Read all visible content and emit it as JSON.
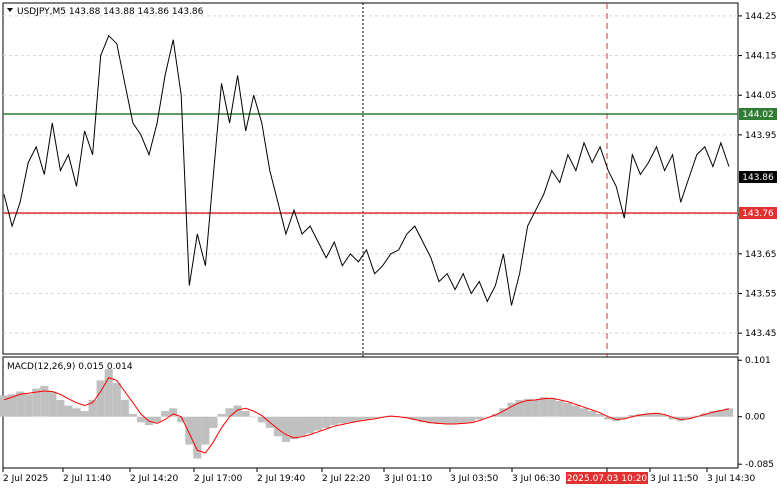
{
  "header": {
    "symbol_line": "USDJPY,M5  143.88 143.88 143.86 143.86"
  },
  "macd_panel": {
    "label": "MACD(12,26,9) 0.015 0.014"
  },
  "price_levels": {
    "resistance": {
      "label": "144.02",
      "value": 144.02,
      "color": "#2e7d32"
    },
    "support": {
      "label": "143.76",
      "value": 143.76,
      "color": "#e03030"
    },
    "current": {
      "label": "143.86",
      "value": 143.86
    }
  },
  "chart_data": [
    {
      "type": "line",
      "title": "USDJPY,M5",
      "ylim": [
        143.4,
        144.28
      ],
      "y_ticks": [
        "144.25",
        "144.15",
        "144.05",
        "143.95",
        "143.75",
        "143.65",
        "143.55",
        "143.45"
      ],
      "x_tick_labels": [
        "2 Jul 2025",
        "2 Jul 11:40",
        "2 Jul 14:20",
        "2 Jul 17:00",
        "2 Jul 19:40",
        "2 Jul 22:20",
        "3 Jul 01:10",
        "3 Jul 03:50",
        "3 Jul 06:30",
        "2025.07.03 10:20",
        "3 Jul 11:50",
        "3 Jul 14:30"
      ],
      "highlighted_x_label": "2025.07.03 10:20",
      "series": [
        {
          "values": [
            143.8,
            143.72,
            143.78,
            143.88,
            143.92,
            143.85,
            143.98,
            143.86,
            143.9,
            143.82,
            143.96,
            143.9,
            144.15,
            144.2,
            144.18,
            144.08,
            143.98,
            143.95,
            143.9,
            143.98,
            144.1,
            144.19,
            144.05,
            143.57,
            143.7,
            143.62,
            143.85,
            144.08,
            143.98,
            144.1,
            143.96,
            144.05,
            143.98,
            143.86,
            143.78,
            143.7,
            143.76,
            143.7,
            143.72,
            143.68,
            143.64,
            143.68,
            143.62,
            143.65,
            143.63,
            143.66,
            143.6,
            143.62,
            143.65,
            143.66,
            143.7,
            143.72,
            143.68,
            143.64,
            143.58,
            143.6,
            143.56,
            143.6,
            143.55,
            143.58,
            143.53,
            143.57,
            143.65,
            143.52,
            143.6,
            143.72,
            143.76,
            143.8,
            143.86,
            143.83,
            143.9,
            143.86,
            143.93,
            143.88,
            143.92,
            143.86,
            143.82,
            143.74,
            143.9,
            143.85,
            143.88,
            143.92,
            143.86,
            143.9,
            143.78,
            143.84,
            143.9,
            143.92,
            143.87,
            143.93,
            143.87
          ],
          "color": "#000000"
        }
      ]
    },
    {
      "type": "bar",
      "title": "MACD(12,26,9)",
      "ylim": [
        -0.09,
        0.105
      ],
      "y_ticks": [
        "0.101",
        "0.00",
        "-0.085"
      ],
      "series": [
        {
          "name": "MACD",
          "values": [
            0.038,
            0.04,
            0.045,
            0.04,
            0.05,
            0.055,
            0.045,
            0.03,
            0.02,
            0.015,
            0.01,
            0.03,
            0.065,
            0.085,
            0.06,
            0.03,
            0.005,
            -0.01,
            -0.015,
            -0.01,
            0.01,
            0.015,
            -0.01,
            -0.05,
            -0.075,
            -0.05,
            -0.02,
            0.005,
            0.015,
            0.02,
            0.01,
            0.0,
            -0.01,
            -0.02,
            -0.035,
            -0.045,
            -0.04,
            -0.035,
            -0.03,
            -0.025,
            -0.02,
            -0.015,
            -0.012,
            -0.01,
            -0.008,
            -0.005,
            -0.003,
            0.0,
            0.002,
            0.0,
            -0.003,
            -0.006,
            -0.01,
            -0.012,
            -0.013,
            -0.014,
            -0.013,
            -0.012,
            -0.01,
            -0.005,
            0.0,
            0.005,
            0.015,
            0.025,
            0.03,
            0.032,
            0.03,
            0.035,
            0.033,
            0.028,
            0.025,
            0.02,
            0.015,
            0.01,
            0.005,
            -0.005,
            -0.008,
            -0.003,
            0.003,
            0.005,
            0.006,
            0.007,
            0.003,
            -0.005,
            -0.008,
            -0.004,
            0.002,
            0.006,
            0.01,
            0.012,
            0.015
          ],
          "color": "#c0c0c0"
        },
        {
          "name": "Signal",
          "values": [
            0.03,
            0.035,
            0.04,
            0.042,
            0.044,
            0.046,
            0.045,
            0.04,
            0.032,
            0.025,
            0.02,
            0.025,
            0.045,
            0.07,
            0.065,
            0.045,
            0.025,
            0.005,
            -0.008,
            -0.012,
            -0.005,
            0.005,
            0.0,
            -0.03,
            -0.06,
            -0.065,
            -0.045,
            -0.02,
            0.0,
            0.012,
            0.015,
            0.01,
            0.002,
            -0.01,
            -0.022,
            -0.032,
            -0.038,
            -0.036,
            -0.032,
            -0.027,
            -0.022,
            -0.017,
            -0.014,
            -0.011,
            -0.008,
            -0.006,
            -0.004,
            -0.001,
            0.001,
            0.0,
            -0.002,
            -0.005,
            -0.008,
            -0.011,
            -0.012,
            -0.013,
            -0.013,
            -0.012,
            -0.011,
            -0.007,
            -0.002,
            0.003,
            0.01,
            0.018,
            0.025,
            0.029,
            0.03,
            0.032,
            0.033,
            0.03,
            0.027,
            0.022,
            0.017,
            0.012,
            0.007,
            0.0,
            -0.005,
            -0.004,
            0.0,
            0.003,
            0.005,
            0.006,
            0.004,
            -0.001,
            -0.005,
            -0.004,
            0.0,
            0.004,
            0.008,
            0.011,
            0.014
          ],
          "color": "#ff0000"
        }
      ]
    }
  ]
}
